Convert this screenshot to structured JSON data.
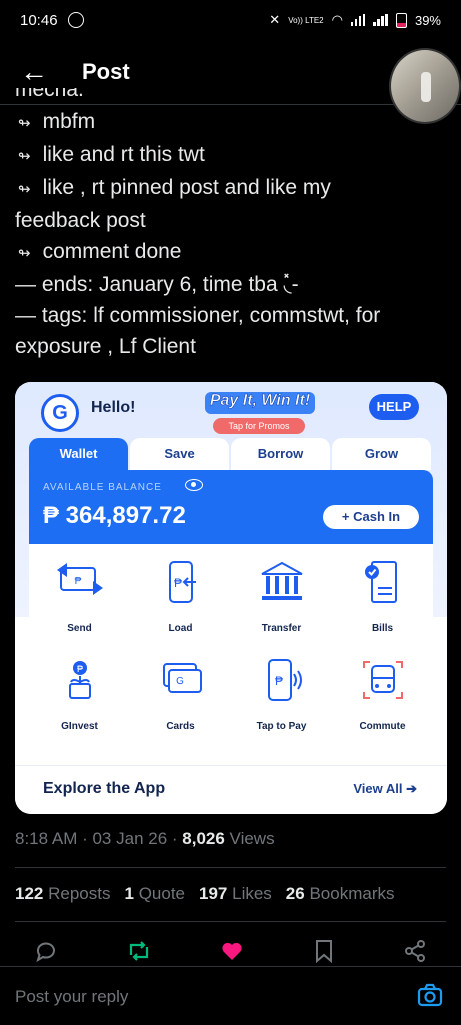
{
  "status_bar": {
    "time": "10:46",
    "network": "Vo)) LTE2",
    "battery": "39%"
  },
  "header": {
    "title": "Post"
  },
  "tweet": {
    "cut_line": "mecha.",
    "lines": [
      "mbfm",
      "like and rt this twt",
      "like , rt pinned post and like my",
      "feedback post",
      "comment done",
      "— ends: January 6, time tba ◟̽-",
      "— tags: lf commissioner, commstwt, for",
      "exposure , Lf Client"
    ]
  },
  "gcash": {
    "logo": "G",
    "hello": "Hello!",
    "promo_title": "Pay It, Win It!",
    "promo_sub": "Tap for Promos",
    "help": "HELP",
    "tabs": [
      "Wallet",
      "Save",
      "Borrow",
      "Grow"
    ],
    "balance_label": "AVAILABLE BALANCE",
    "balance": "₱ 364,897.72",
    "cash_in": "+ Cash In",
    "services": [
      "Send",
      "Load",
      "Transfer",
      "Bills",
      "GInvest",
      "Cards",
      "Tap to Pay",
      "Commute"
    ],
    "explore": "Explore the App",
    "view_all": "View All ➔"
  },
  "meta": {
    "time": "8:18 AM · 03 Jan 26 · ",
    "views_count": "8,026",
    "views_label": " Views"
  },
  "stats": {
    "reposts": "122",
    "reposts_label": "Reposts",
    "quote": "1",
    "quote_label": "Quote",
    "likes": "197",
    "likes_label": "Likes",
    "bookmarks": "26",
    "bookmarks_label": "Bookmarks"
  },
  "reply": {
    "placeholder": "Post your reply"
  },
  "colors": {
    "like": "#f91880",
    "repost": "#00ba7c",
    "gcash_blue": "#1d6ef2"
  }
}
